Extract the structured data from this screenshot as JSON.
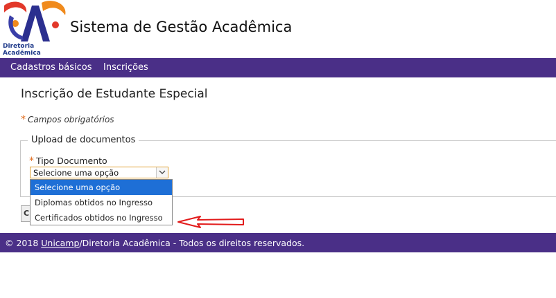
{
  "header": {
    "logo_caption": "Diretoria Acadêmica",
    "title": "Sistema de Gestão Acadêmica"
  },
  "nav": {
    "items": [
      {
        "label": "Cadastros básicos"
      },
      {
        "label": "Inscrições"
      }
    ]
  },
  "main": {
    "page_title": "Inscrição de Estudante Especial",
    "required_note": "Campos obrigatórios",
    "required_mark": "*",
    "fieldset_legend": "Upload de documentos",
    "doc_type": {
      "label": "Tipo Documento",
      "selected_value": "Selecione uma opção",
      "options": [
        "Selecione uma opção",
        "Diplomas obtidos no Ingresso",
        "Certificados obtidos no Ingresso"
      ]
    },
    "partial_button_text": "C"
  },
  "footer": {
    "prefix": "© 2018 ",
    "link": "Unicamp",
    "suffix": "/Diretoria Acadêmica - Todos os direitos reservados."
  },
  "colors": {
    "nav_bg": "#4a2f87",
    "accent_orange": "#e06b1c",
    "selected_option": "#1e6fd6",
    "annotation_arrow": "#e21b1b"
  }
}
